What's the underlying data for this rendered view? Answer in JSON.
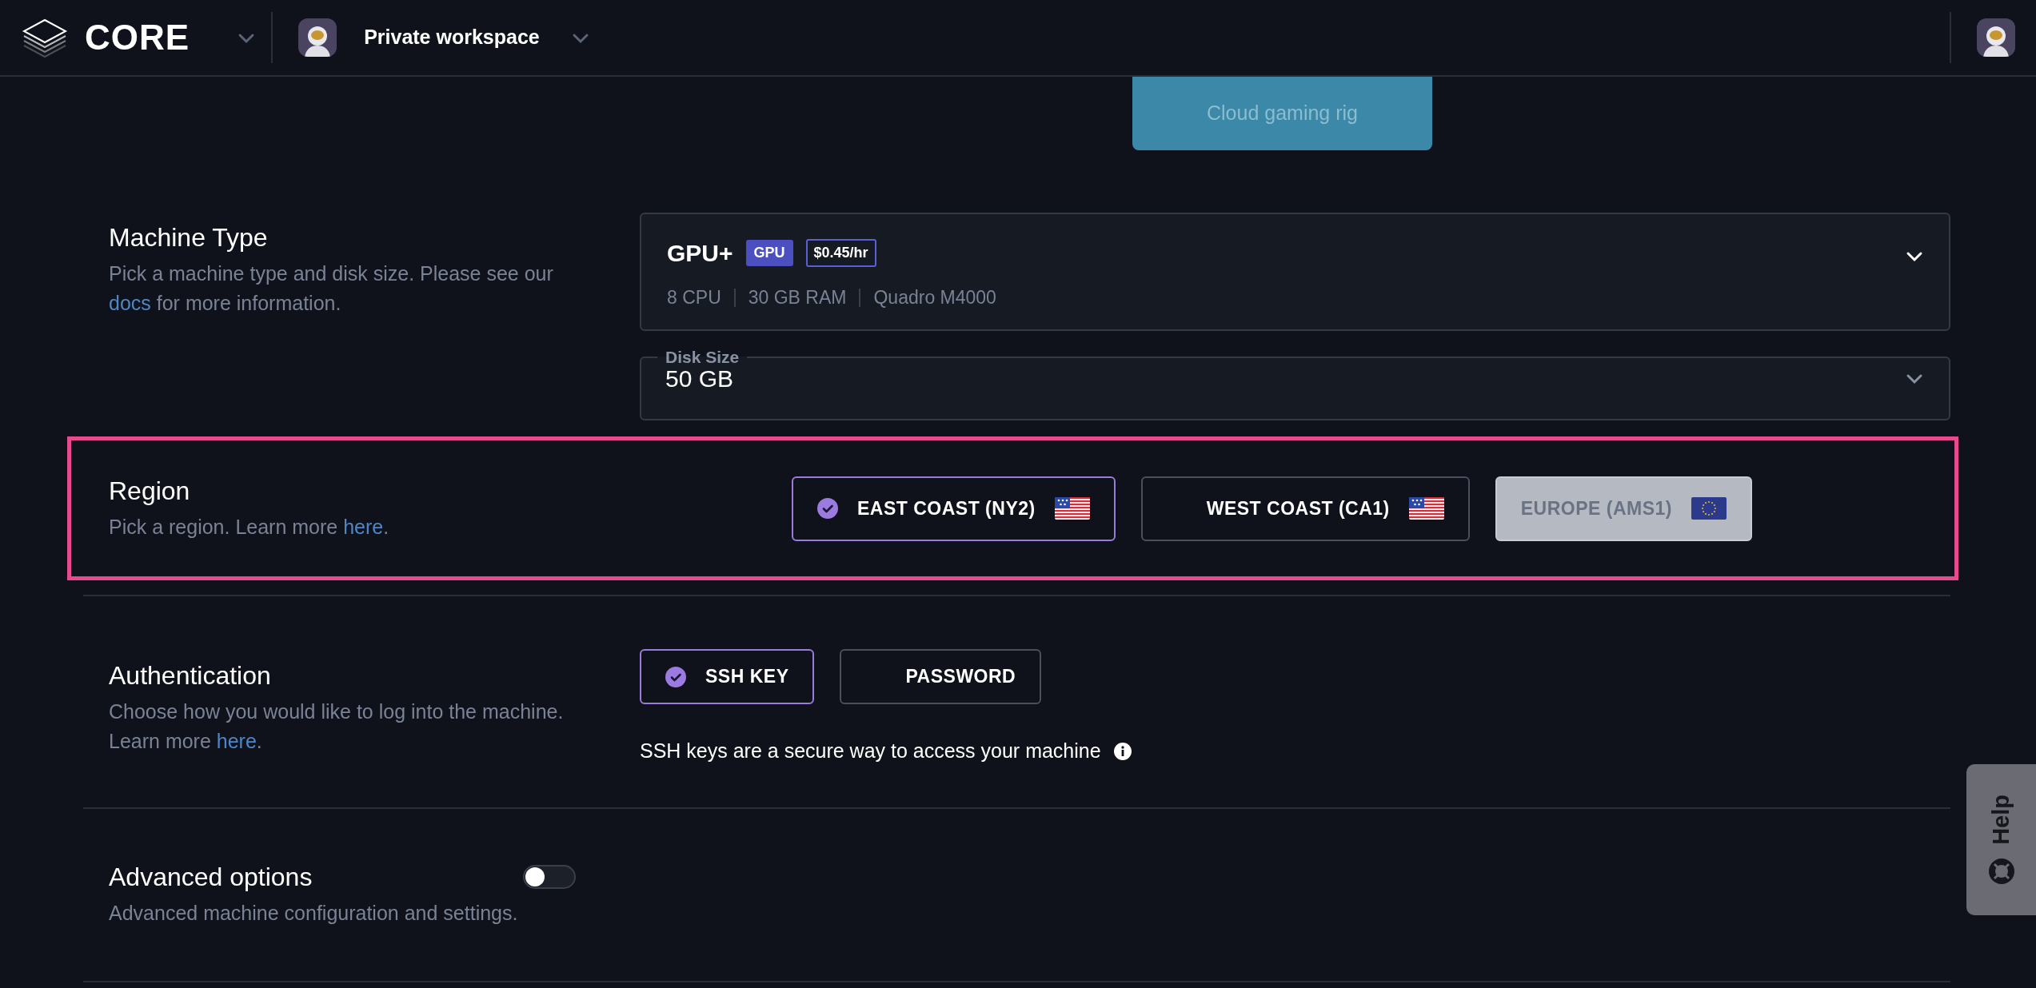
{
  "header": {
    "logo": "CORE",
    "workspace": "Private workspace"
  },
  "template": {
    "label": "Cloud gaming rig"
  },
  "machine_type": {
    "title": "Machine Type",
    "description": {
      "before": "Pick a machine type and disk size. Please see our ",
      "link": "docs",
      "after": " for more information."
    },
    "machine": {
      "name": "GPU+",
      "badges": [
        {
          "kind": "type",
          "text": "GPU"
        },
        {
          "kind": "price",
          "text": "$0.45/hr"
        }
      ],
      "specs": [
        "8 CPU",
        "30 GB RAM",
        "Quadro M4000"
      ]
    },
    "disk": {
      "label": "Disk Size",
      "value": "50 GB"
    }
  },
  "region": {
    "title": "Region",
    "highlighted": true,
    "description": {
      "before": "Pick a region. Learn more ",
      "link": "here",
      "after": "."
    },
    "options": [
      {
        "label": "EAST COAST (NY2)",
        "flag": {
          "kind": "us"
        },
        "selected": true,
        "disabled": false
      },
      {
        "label": "WEST COAST (CA1)",
        "flag": {
          "kind": "us"
        },
        "selected": false,
        "disabled": false
      },
      {
        "label": "EUROPE (AMS1)",
        "flag": {
          "kind": "eu"
        },
        "selected": false,
        "disabled": true
      }
    ]
  },
  "authentication": {
    "title": "Authentication",
    "description": {
      "before": "Choose how you would like to log into the machine. Learn more ",
      "link": "here",
      "after": "."
    },
    "options": [
      {
        "label": "SSH KEY",
        "selected": true
      },
      {
        "label": "PASSWORD",
        "selected": false
      }
    ],
    "note": "SSH keys are a secure way to access your machine"
  },
  "advanced": {
    "title": "Advanced options",
    "description": "Advanced machine configuration and settings.",
    "on": false
  },
  "help_tab": {
    "label": "Help"
  }
}
